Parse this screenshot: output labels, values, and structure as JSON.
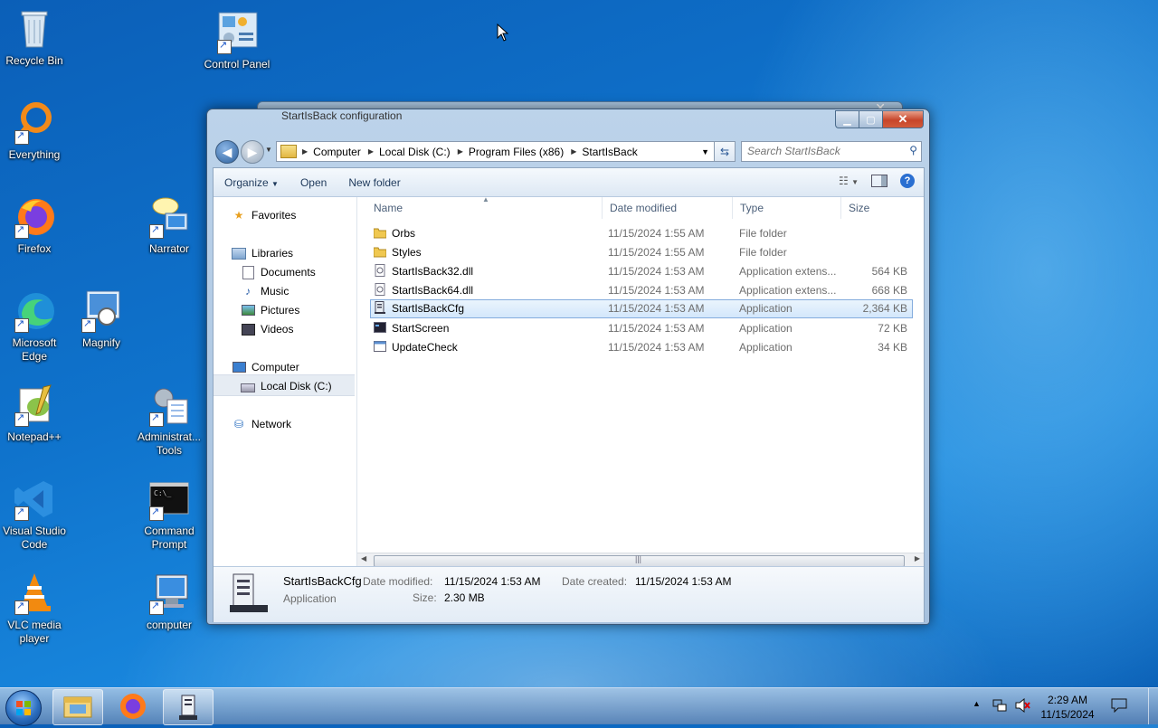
{
  "desktop": {
    "icons": [
      {
        "label": "Recycle Bin",
        "icon": "recycle-bin-icon"
      },
      {
        "label": "Control Panel",
        "icon": "control-panel-icon"
      },
      {
        "label": "Everything",
        "icon": "everything-icon"
      },
      {
        "label": "Firefox",
        "icon": "firefox-icon"
      },
      {
        "label": "Narrator",
        "icon": "narrator-icon"
      },
      {
        "label": "Microsoft Edge",
        "icon": "edge-icon"
      },
      {
        "label": "Magnify",
        "icon": "magnify-icon"
      },
      {
        "label": "Notepad++",
        "icon": "notepadpp-icon"
      },
      {
        "label": "Administrat... Tools",
        "icon": "admin-tools-icon"
      },
      {
        "label": "Visual Studio Code",
        "icon": "vscode-icon"
      },
      {
        "label": "Command Prompt",
        "icon": "cmd-icon"
      },
      {
        "label": "VLC media player",
        "icon": "vlc-icon"
      },
      {
        "label": "computer",
        "icon": "computer-icon"
      }
    ]
  },
  "background_window": {
    "title": "StartIsBack configuration"
  },
  "explorer": {
    "breadcrumb": [
      "Computer",
      "Local Disk (C:)",
      "Program Files (x86)",
      "StartIsBack"
    ],
    "search_placeholder": "Search StartIsBack",
    "toolbar": {
      "organize": "Organize",
      "open": "Open",
      "new_folder": "New folder"
    },
    "nav": {
      "favorites": "Favorites",
      "libraries": "Libraries",
      "documents": "Documents",
      "music": "Music",
      "pictures": "Pictures",
      "videos": "Videos",
      "computer": "Computer",
      "local_disk": "Local Disk (C:)",
      "network": "Network"
    },
    "columns": {
      "name": "Name",
      "date": "Date modified",
      "type": "Type",
      "size": "Size"
    },
    "files": [
      {
        "name": "Orbs",
        "date": "11/15/2024 1:55 AM",
        "type": "File folder",
        "size": ""
      },
      {
        "name": "Styles",
        "date": "11/15/2024 1:55 AM",
        "type": "File folder",
        "size": ""
      },
      {
        "name": "StartIsBack32.dll",
        "date": "11/15/2024 1:53 AM",
        "type": "Application extens...",
        "size": "564 KB"
      },
      {
        "name": "StartIsBack64.dll",
        "date": "11/15/2024 1:53 AM",
        "type": "Application extens...",
        "size": "668 KB"
      },
      {
        "name": "StartIsBackCfg",
        "date": "11/15/2024 1:53 AM",
        "type": "Application",
        "size": "2,364 KB"
      },
      {
        "name": "StartScreen",
        "date": "11/15/2024 1:53 AM",
        "type": "Application",
        "size": "72 KB"
      },
      {
        "name": "UpdateCheck",
        "date": "11/15/2024 1:53 AM",
        "type": "Application",
        "size": "34 KB"
      }
    ],
    "details": {
      "name": "StartIsBackCfg",
      "kind": "Application",
      "date_modified_label": "Date modified:",
      "date_modified": "11/15/2024 1:53 AM",
      "date_created_label": "Date created:",
      "date_created": "11/15/2024 1:53 AM",
      "size_label": "Size:",
      "size": "2.30 MB"
    }
  },
  "taskbar": {
    "time": "2:29 AM",
    "date": "11/15/2024"
  }
}
